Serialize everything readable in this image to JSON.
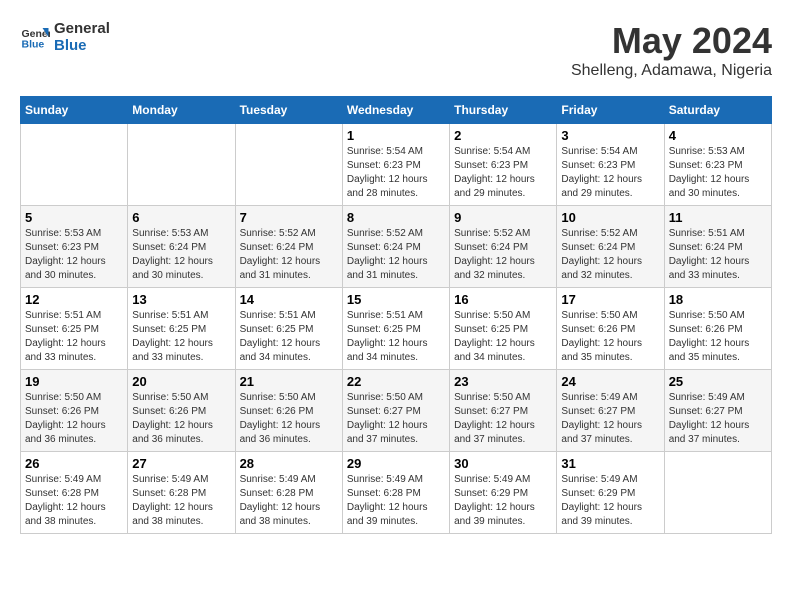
{
  "header": {
    "logo_line1": "General",
    "logo_line2": "Blue",
    "title": "May 2024",
    "subtitle": "Shelleng, Adamawa, Nigeria"
  },
  "weekdays": [
    "Sunday",
    "Monday",
    "Tuesday",
    "Wednesday",
    "Thursday",
    "Friday",
    "Saturday"
  ],
  "weeks": [
    [
      {
        "day": "",
        "info": ""
      },
      {
        "day": "",
        "info": ""
      },
      {
        "day": "",
        "info": ""
      },
      {
        "day": "1",
        "info": "Sunrise: 5:54 AM\nSunset: 6:23 PM\nDaylight: 12 hours\nand 28 minutes."
      },
      {
        "day": "2",
        "info": "Sunrise: 5:54 AM\nSunset: 6:23 PM\nDaylight: 12 hours\nand 29 minutes."
      },
      {
        "day": "3",
        "info": "Sunrise: 5:54 AM\nSunset: 6:23 PM\nDaylight: 12 hours\nand 29 minutes."
      },
      {
        "day": "4",
        "info": "Sunrise: 5:53 AM\nSunset: 6:23 PM\nDaylight: 12 hours\nand 30 minutes."
      }
    ],
    [
      {
        "day": "5",
        "info": "Sunrise: 5:53 AM\nSunset: 6:23 PM\nDaylight: 12 hours\nand 30 minutes."
      },
      {
        "day": "6",
        "info": "Sunrise: 5:53 AM\nSunset: 6:24 PM\nDaylight: 12 hours\nand 30 minutes."
      },
      {
        "day": "7",
        "info": "Sunrise: 5:52 AM\nSunset: 6:24 PM\nDaylight: 12 hours\nand 31 minutes."
      },
      {
        "day": "8",
        "info": "Sunrise: 5:52 AM\nSunset: 6:24 PM\nDaylight: 12 hours\nand 31 minutes."
      },
      {
        "day": "9",
        "info": "Sunrise: 5:52 AM\nSunset: 6:24 PM\nDaylight: 12 hours\nand 32 minutes."
      },
      {
        "day": "10",
        "info": "Sunrise: 5:52 AM\nSunset: 6:24 PM\nDaylight: 12 hours\nand 32 minutes."
      },
      {
        "day": "11",
        "info": "Sunrise: 5:51 AM\nSunset: 6:24 PM\nDaylight: 12 hours\nand 33 minutes."
      }
    ],
    [
      {
        "day": "12",
        "info": "Sunrise: 5:51 AM\nSunset: 6:25 PM\nDaylight: 12 hours\nand 33 minutes."
      },
      {
        "day": "13",
        "info": "Sunrise: 5:51 AM\nSunset: 6:25 PM\nDaylight: 12 hours\nand 33 minutes."
      },
      {
        "day": "14",
        "info": "Sunrise: 5:51 AM\nSunset: 6:25 PM\nDaylight: 12 hours\nand 34 minutes."
      },
      {
        "day": "15",
        "info": "Sunrise: 5:51 AM\nSunset: 6:25 PM\nDaylight: 12 hours\nand 34 minutes."
      },
      {
        "day": "16",
        "info": "Sunrise: 5:50 AM\nSunset: 6:25 PM\nDaylight: 12 hours\nand 34 minutes."
      },
      {
        "day": "17",
        "info": "Sunrise: 5:50 AM\nSunset: 6:26 PM\nDaylight: 12 hours\nand 35 minutes."
      },
      {
        "day": "18",
        "info": "Sunrise: 5:50 AM\nSunset: 6:26 PM\nDaylight: 12 hours\nand 35 minutes."
      }
    ],
    [
      {
        "day": "19",
        "info": "Sunrise: 5:50 AM\nSunset: 6:26 PM\nDaylight: 12 hours\nand 36 minutes."
      },
      {
        "day": "20",
        "info": "Sunrise: 5:50 AM\nSunset: 6:26 PM\nDaylight: 12 hours\nand 36 minutes."
      },
      {
        "day": "21",
        "info": "Sunrise: 5:50 AM\nSunset: 6:26 PM\nDaylight: 12 hours\nand 36 minutes."
      },
      {
        "day": "22",
        "info": "Sunrise: 5:50 AM\nSunset: 6:27 PM\nDaylight: 12 hours\nand 37 minutes."
      },
      {
        "day": "23",
        "info": "Sunrise: 5:50 AM\nSunset: 6:27 PM\nDaylight: 12 hours\nand 37 minutes."
      },
      {
        "day": "24",
        "info": "Sunrise: 5:49 AM\nSunset: 6:27 PM\nDaylight: 12 hours\nand 37 minutes."
      },
      {
        "day": "25",
        "info": "Sunrise: 5:49 AM\nSunset: 6:27 PM\nDaylight: 12 hours\nand 37 minutes."
      }
    ],
    [
      {
        "day": "26",
        "info": "Sunrise: 5:49 AM\nSunset: 6:28 PM\nDaylight: 12 hours\nand 38 minutes."
      },
      {
        "day": "27",
        "info": "Sunrise: 5:49 AM\nSunset: 6:28 PM\nDaylight: 12 hours\nand 38 minutes."
      },
      {
        "day": "28",
        "info": "Sunrise: 5:49 AM\nSunset: 6:28 PM\nDaylight: 12 hours\nand 38 minutes."
      },
      {
        "day": "29",
        "info": "Sunrise: 5:49 AM\nSunset: 6:28 PM\nDaylight: 12 hours\nand 39 minutes."
      },
      {
        "day": "30",
        "info": "Sunrise: 5:49 AM\nSunset: 6:29 PM\nDaylight: 12 hours\nand 39 minutes."
      },
      {
        "day": "31",
        "info": "Sunrise: 5:49 AM\nSunset: 6:29 PM\nDaylight: 12 hours\nand 39 minutes."
      },
      {
        "day": "",
        "info": ""
      }
    ]
  ]
}
